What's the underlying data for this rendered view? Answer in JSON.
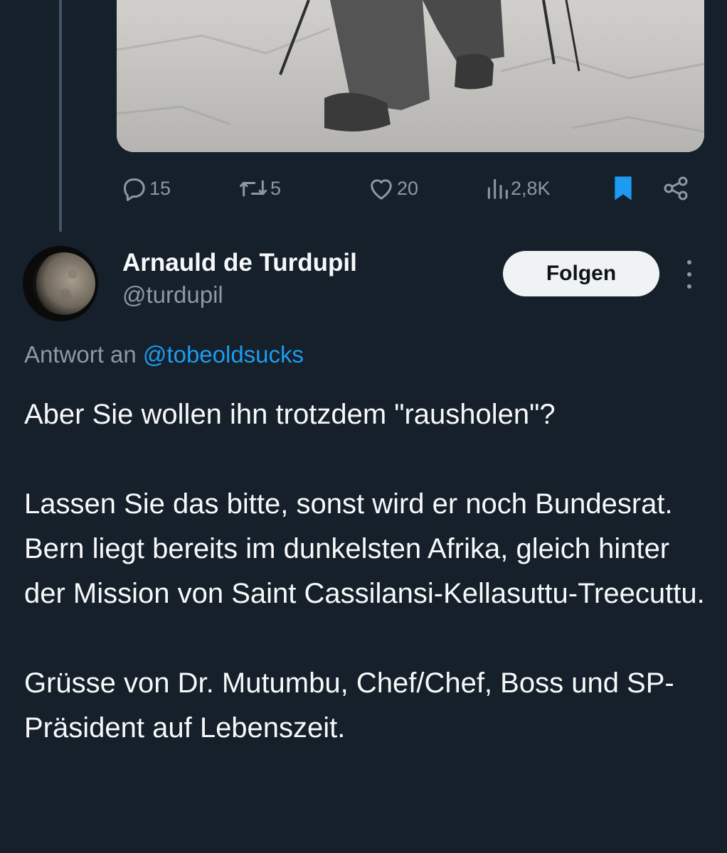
{
  "media": {
    "alt_icon": "photo-of-person-with-trekking-poles"
  },
  "actions": {
    "reply_count": "15",
    "retweet_count": "5",
    "like_count": "20",
    "view_count": "2,8K",
    "reply_icon": "reply-icon",
    "retweet_icon": "retweet-icon",
    "like_icon": "heart-icon",
    "views_icon": "views-icon",
    "bookmark_icon": "bookmark-icon",
    "share_icon": "share-icon",
    "bookmark_color": "#1d9bf0"
  },
  "author": {
    "name": "Arnauld de Turdupil",
    "handle": "@turdupil"
  },
  "follow_label": "Folgen",
  "reply_to": {
    "prefix": "Antwort an",
    "mention": "@tobeoldsucks"
  },
  "tweet": {
    "line1": "Aber Sie wollen ihn trotzdem \"rausholen\"?",
    "line2": "Lassen Sie das bitte, sonst wird er noch Bundesrat.",
    "line3": "Bern liegt bereits im dunkelsten Afrika, gleich hinter der Mission von Saint Cassilansi-Kellasuttu-Treecuttu.",
    "line4": "Grüsse von Dr. Mutumbu, Chef/Chef, Boss und SP-Präsident auf Lebenszeit."
  },
  "colors": {
    "background": "#15202b",
    "text": "#f7f9f9",
    "secondary": "#8b98a5",
    "accent": "#1d9bf0"
  }
}
